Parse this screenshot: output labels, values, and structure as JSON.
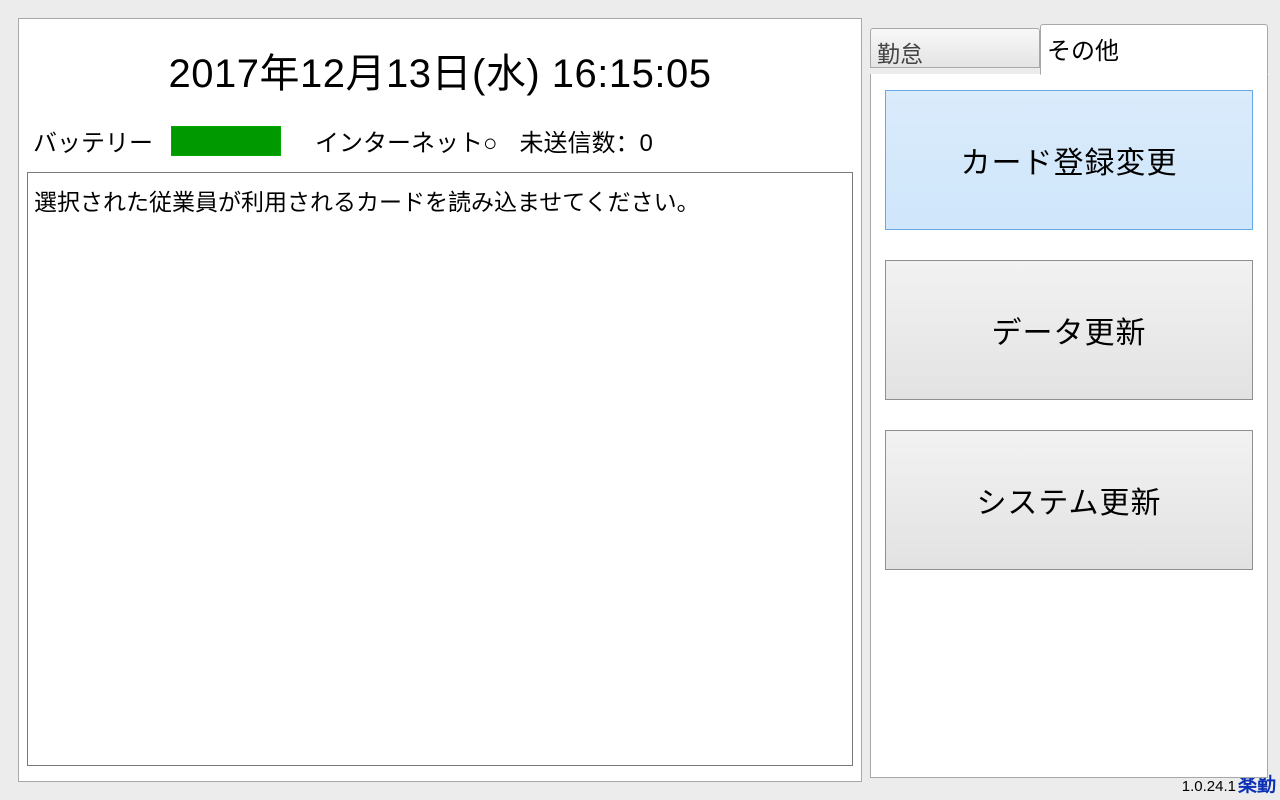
{
  "header": {
    "datetime": "2017年12月13日(水) 16:15:05"
  },
  "status": {
    "battery_label": "バッテリー",
    "battery_color": "#009900",
    "internet_status": "インターネット○",
    "unsent_label": "未送信数：0"
  },
  "message": "選択された従業員が利用されるカードを読み込ませてください。",
  "tabs": {
    "attendance": "勤怠",
    "other": "その他"
  },
  "side_buttons": {
    "card_register": "カード登録変更",
    "data_update": "データ更新",
    "system_update": "システム更新"
  },
  "footer": {
    "version": "1.0.24.1",
    "logo": "楽勤"
  }
}
